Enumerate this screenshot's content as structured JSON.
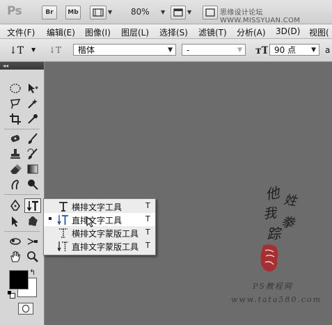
{
  "appbar": {
    "logo": "Ps",
    "bridge_label": "Br",
    "minibridge_label": "Mb",
    "zoom": "80%",
    "watermark": "思缘设计论坛 WWW.MISSYUAN.COM"
  },
  "menubar": {
    "items": [
      "文件(F)",
      "编辑(E)",
      "图像(I)",
      "图层(L)",
      "选择(S)",
      "滤镜(T)",
      "分析(A)",
      "3D(D)",
      "视图("
    ]
  },
  "options": {
    "font_family": "楷体",
    "font_style": "-",
    "font_size": "90 点",
    "overflow_text": "a"
  },
  "toolbox": {
    "collapse_glyph": "◂◂"
  },
  "flyout": {
    "items": [
      {
        "label": "横排文字工具",
        "key": "T",
        "selected": false
      },
      {
        "label": "直排文字工具",
        "key": "T",
        "selected": true
      },
      {
        "label": "横排文字蒙版工具",
        "key": "T",
        "selected": false
      },
      {
        "label": "直排文字蒙版工具",
        "key": "T",
        "selected": false
      }
    ]
  },
  "artwork": {
    "calligraphy": [
      "他",
      "姓",
      "我",
      "拳",
      "踪"
    ],
    "site_name": "PS教程网",
    "url": "www.tata580.com"
  },
  "colors": {
    "foreground": "#000000",
    "background": "#ffffff",
    "canvas": "#6c6c6c",
    "seal_red": "#b0262a"
  }
}
